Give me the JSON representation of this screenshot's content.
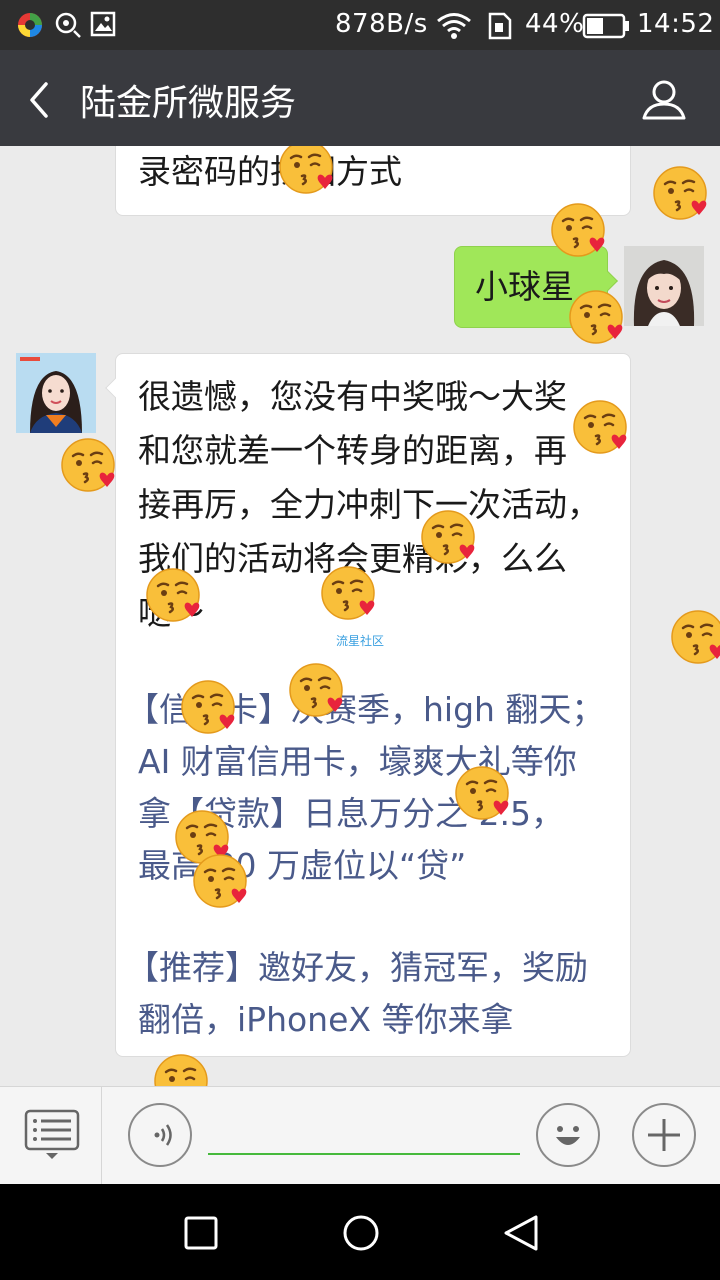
{
  "status_bar": {
    "network_speed": "878B/s",
    "battery_percent": "44%",
    "time": "14:52",
    "icons": [
      "app-logo-icon",
      "location-icon",
      "image-icon",
      "wifi-icon",
      "sim-icon",
      "battery-icon"
    ]
  },
  "header": {
    "title": "陆金所微服务",
    "back_icon": "back-arrow-icon",
    "profile_icon": "person-icon"
  },
  "messages": [
    {
      "direction": "incoming",
      "lines": [
        "录密码的找回方式"
      ]
    },
    {
      "direction": "outgoing",
      "lines": [
        "小球星"
      ]
    },
    {
      "direction": "incoming",
      "lines": [
        "很遗憾，您没有中奖哦～大奖",
        "和您就差一个转身的距离，再",
        "接再厉，全力冲刺下一次活动，",
        "我们的活动将会更精彩，么么",
        "哒～"
      ],
      "watermark": "流星社区",
      "promo_lines": [
        "【信用卡】决赛季，high 翻天；",
        "AI 财富信用卡，壕爽大礼等你",
        "拿【贷款】日息万分之 2.5，",
        "最高 30 万虚位以“贷”"
      ],
      "recommend_lines": [
        "【推荐】邀好友，猜冠军，奖励",
        "翻倍，iPhoneX 等你来拿"
      ]
    }
  ],
  "input_bar": {
    "menu_icon": "menu-list-icon",
    "voice_icon": "voice-icon",
    "emoji_icon": "smiley-icon",
    "plus_icon": "plus-icon",
    "text_value": ""
  },
  "colors": {
    "nav_bg": "#393a3f",
    "outgoing_bubble": "#a0e759",
    "link_text": "#4a5a8a",
    "input_underline": "#46b93c"
  }
}
